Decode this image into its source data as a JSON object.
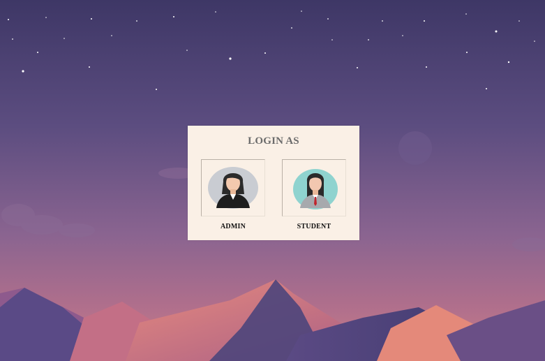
{
  "login_card": {
    "title": "LOGIN AS",
    "options": [
      {
        "label": "ADMIN",
        "icon": "admin-avatar-icon"
      },
      {
        "label": "STUDENT",
        "icon": "student-avatar-icon"
      }
    ]
  },
  "colors": {
    "sky_top": "#3e3766",
    "sky_bottom": "#b4738a",
    "card_background": "#faf0e6",
    "title_text": "#6b6b6b",
    "label_text": "#111111"
  }
}
